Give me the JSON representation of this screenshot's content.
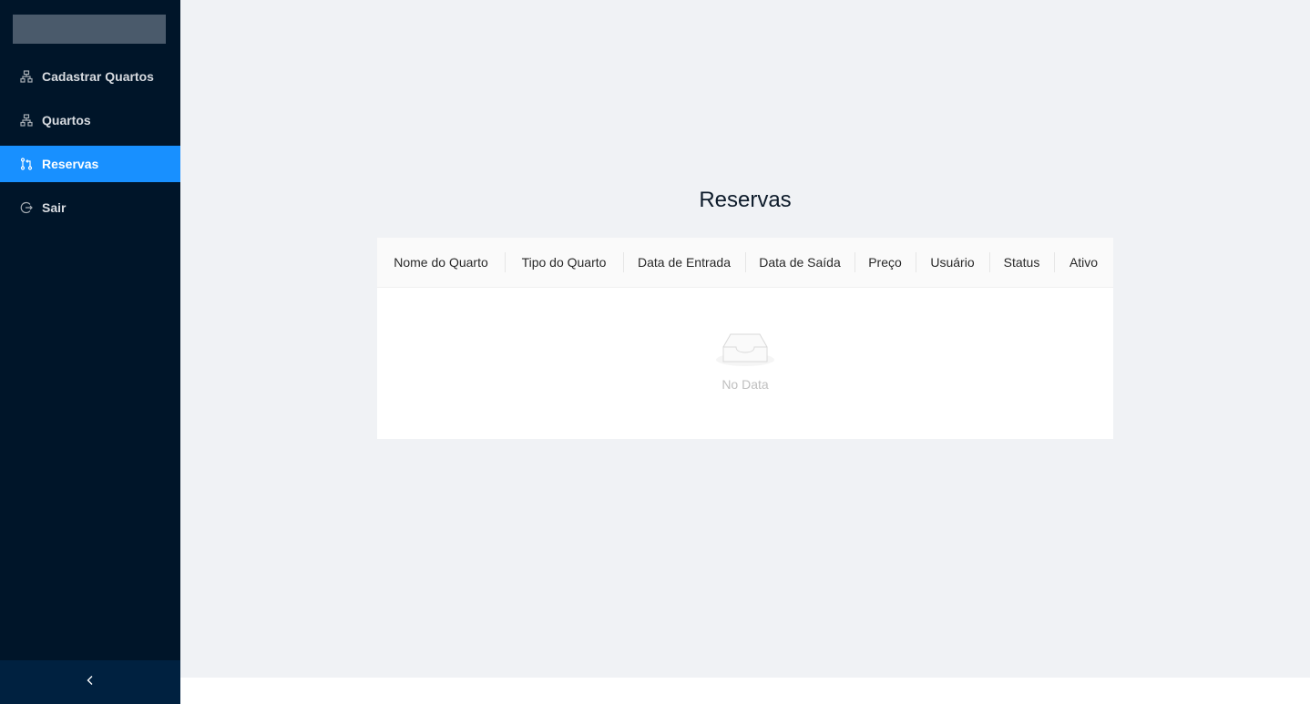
{
  "sidebar": {
    "items": [
      {
        "label": "Cadastrar Quartos",
        "icon": "apartment-icon",
        "active": false
      },
      {
        "label": "Quartos",
        "icon": "apartment-icon",
        "active": false
      },
      {
        "label": "Reservas",
        "icon": "pull-request-icon",
        "active": true
      },
      {
        "label": "Sair",
        "icon": "logout-icon",
        "active": false
      }
    ],
    "collapse_icon": "chevron-left-icon"
  },
  "main": {
    "title": "Reservas",
    "table": {
      "columns": [
        "Nome do Quarto",
        "Tipo do Quarto",
        "Data de Entrada",
        "Data de Saída",
        "Preço",
        "Usuário",
        "Status",
        "Ativo"
      ],
      "rows": [],
      "empty_text": "No Data",
      "empty_icon": "inbox-icon"
    }
  },
  "colors": {
    "sidebar_bg": "#001529",
    "active_item": "#1890ff",
    "content_bg": "#f0f2f5"
  }
}
